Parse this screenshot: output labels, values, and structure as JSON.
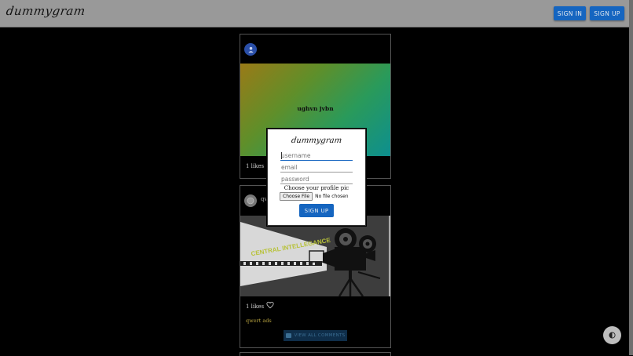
{
  "header": {
    "logo_text": "dummygram",
    "sign_in_label": "SIGN IN",
    "sign_up_label": "SIGN UP"
  },
  "posts": [
    {
      "image_text": "ughvn jvbn",
      "likes": "1 likes"
    },
    {
      "username": "qw",
      "likes": "1 likes",
      "caption": "qwert ads",
      "view_comments_label": "VIEW ALL COMMENTS",
      "image_sign_text": "CENTRAL INTELLEGANCE"
    }
  ],
  "modal": {
    "logo_text": "dummygram",
    "username_placeholder": "username",
    "email_placeholder": "email",
    "password_placeholder": "password",
    "profile_pic_label": "Choose your profile pic",
    "choose_file_label": "Choose File",
    "no_file_text": "No file chosen",
    "sign_up_label": "SIGN UP"
  },
  "colors": {
    "primary": "#1565c0",
    "header_bg": "#999999",
    "caption": "#b8a340"
  },
  "icons": {
    "avatar": "person-icon",
    "like": "heart-outline-icon",
    "comments": "comment-icon",
    "theme_toggle": "contrast-icon"
  }
}
